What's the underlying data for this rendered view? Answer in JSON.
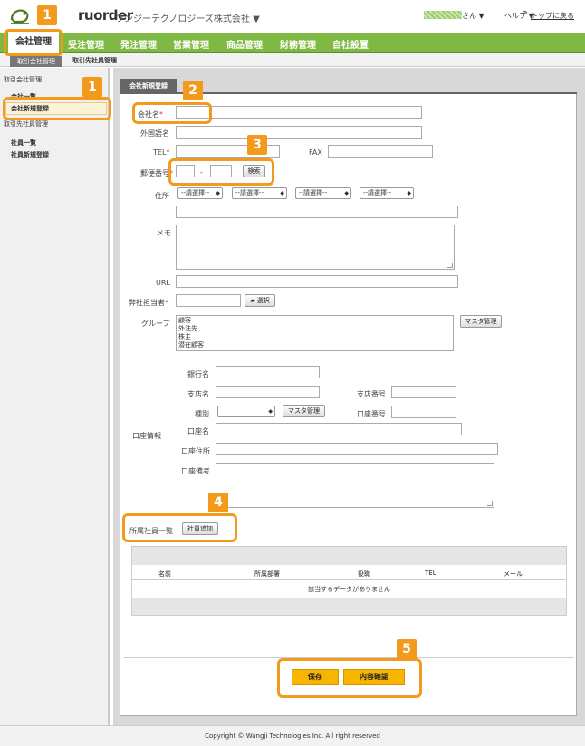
{
  "header": {
    "logo": "ruorder",
    "company": "ワンジーテクノロジーズ株式会社 ▼",
    "user_suffix": "さん ▼",
    "help": "ヘルプ ▼",
    "top_link": "トップに戻る"
  },
  "nav": {
    "items": [
      "会社管理",
      "受注管理",
      "発注管理",
      "営業管理",
      "商品管理",
      "財務管理",
      "自社設置"
    ]
  },
  "subnav": {
    "active": "取引会社管理",
    "other": "取引先社員管理"
  },
  "sidebar": {
    "group1": "取引会社管理",
    "group1_items": [
      "会社一覧",
      "会社新規登録"
    ],
    "group2": "取引先社員管理",
    "group2_items": [
      "社員一覧",
      "社員新規登録"
    ]
  },
  "panel": {
    "tab": "会社新規登録"
  },
  "form": {
    "company_name": "会社名",
    "foreign_name": "外国語名",
    "tel": "TEL",
    "fax": "FAX",
    "zip": "郵便番号",
    "zip_dash": "-",
    "search_button": "検索",
    "address": "住所",
    "select_placeholder": "--請選擇--",
    "memo": "メモ",
    "url": "URL",
    "staff": "弊社担当者",
    "select_button": "選択",
    "group": "グループ",
    "group_options": [
      "顧客",
      "外注先",
      "株主",
      "潜在顧客"
    ],
    "master_button": "マスタ管理",
    "account_info": "口座情報",
    "bank_name": "銀行名",
    "branch_name": "支店名",
    "branch_no": "支店番号",
    "type": "種別",
    "account_no": "口座番号",
    "account_name": "口座名",
    "account_address": "口座住所",
    "account_note": "口座備考",
    "members": "所属社員一覧",
    "add_member_button": "社員追加"
  },
  "table": {
    "columns": [
      "名前",
      "所属部署",
      "役職",
      "TEL",
      "メール"
    ],
    "empty": "該当するデータがありません"
  },
  "actions": {
    "save": "保存",
    "confirm": "内容確認"
  },
  "footer": "Copyright © Wangji Technologies Inc. All right reserved",
  "badges": [
    "1",
    "1",
    "2",
    "3",
    "4",
    "5"
  ],
  "colors": {
    "accent": "#f39a1c",
    "nav": "#7fb842",
    "button": "#f7b500"
  }
}
